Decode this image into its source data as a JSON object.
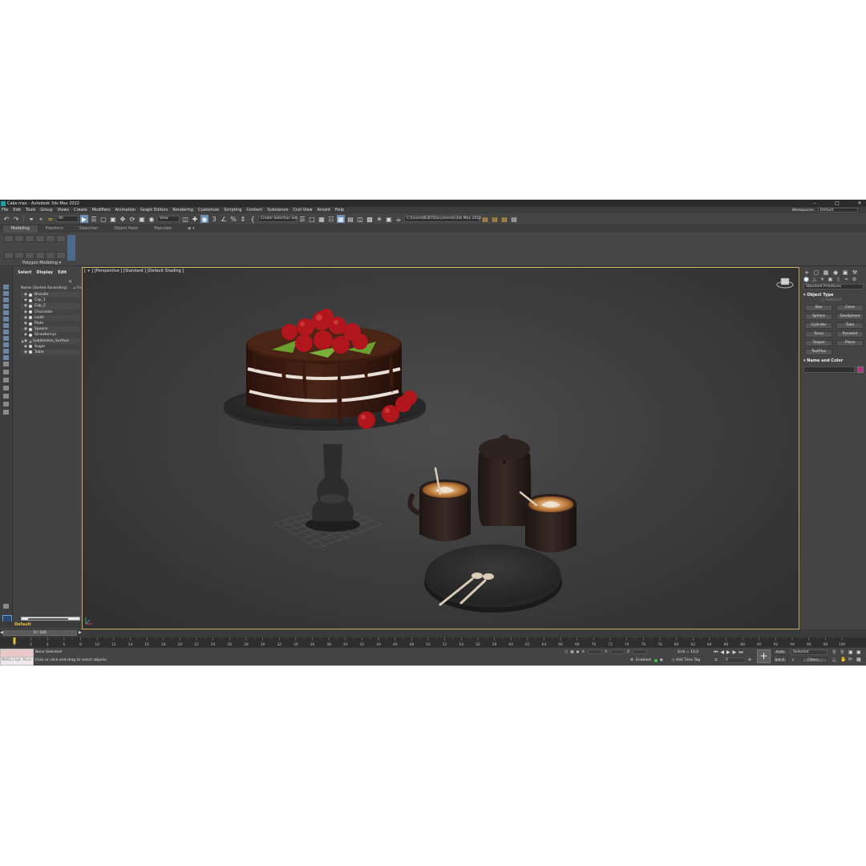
{
  "window": {
    "title": "Cake.max - Autodesk 3ds Max 2022",
    "workspace_label": "Workspaces:",
    "workspace_value": "Default"
  },
  "menu": [
    "File",
    "Edit",
    "Tools",
    "Group",
    "Views",
    "Create",
    "Modifiers",
    "Animation",
    "Graph Editors",
    "Rendering",
    "Customize",
    "Scripting",
    "Content",
    "Substance",
    "Civil View",
    "Arnold",
    "Help"
  ],
  "toolbar": {
    "filter_value": "All",
    "refcoord_value": "View",
    "selection_set_value": "Create Selection Set",
    "project_path": "C:\\Users\\BGBT\\Documents\\3ds Max 2022"
  },
  "ribbon": {
    "tabs": [
      "Modeling",
      "Freeform",
      "Selection",
      "Object Paint",
      "Populate"
    ],
    "panel_label": "Polygon Modeling"
  },
  "explorer": {
    "tabs": [
      "Select",
      "Display",
      "Edit"
    ],
    "column_header": "Name (Sorted Ascending)",
    "column_header_right": "▴ Fro",
    "items": [
      "Biscuits",
      "Cap_1",
      "Cap_2",
      "Chocolate",
      "Leafs",
      "Plate",
      "Spoons",
      "Strawberrys",
      "Subdivision_Surface",
      "Sugar",
      "Table"
    ],
    "layer": "Default"
  },
  "viewport": {
    "label": "[ + ] [Perspective ] [Standard ] [Default Shading ]"
  },
  "command_panel": {
    "dropdown": "Standard Primitives",
    "object_type_title": "Object Type",
    "autogrid_label": "AutoGrid",
    "primitives": [
      "Box",
      "Cone",
      "Sphere",
      "GeoSphere",
      "Cylinder",
      "Tube",
      "Torus",
      "Pyramid",
      "Teapot",
      "Plane",
      "TextPlus"
    ],
    "name_color_title": "Name and Color",
    "object_color": "#b0307a"
  },
  "timeline": {
    "slider_label": "0 / 100",
    "ticks": [
      "0",
      "2",
      "4",
      "6",
      "8",
      "10",
      "12",
      "14",
      "16",
      "18",
      "20",
      "22",
      "24",
      "26",
      "28",
      "30",
      "32",
      "34",
      "36",
      "38",
      "40",
      "42",
      "44",
      "46",
      "48",
      "50",
      "52",
      "54",
      "56",
      "58",
      "60",
      "62",
      "64",
      "66",
      "68",
      "70",
      "72",
      "74",
      "76",
      "78",
      "80",
      "82",
      "84",
      "86",
      "88",
      "90",
      "92",
      "94",
      "96",
      "98",
      "100"
    ]
  },
  "status": {
    "maxscript_label": "MAXScript Mini",
    "selection_msg": "None Selected",
    "prompt": "Click or click-and-drag to select objects",
    "x_label": "X:",
    "y_label": "Y:",
    "z_label": "Z:",
    "grid": "Grid = 10,0",
    "enabled_label": "Enabled:",
    "add_time_tag": "Add Time Tag",
    "frame_value": "0",
    "auto_label": "Auto",
    "selected_value": "Selected",
    "set_key_label": "Set K.",
    "filters_label": "Filters..."
  },
  "colors": {
    "viewport_border": "#c9b061",
    "accent_blue": "#6e8fb5",
    "layer_text": "#f0c040"
  }
}
